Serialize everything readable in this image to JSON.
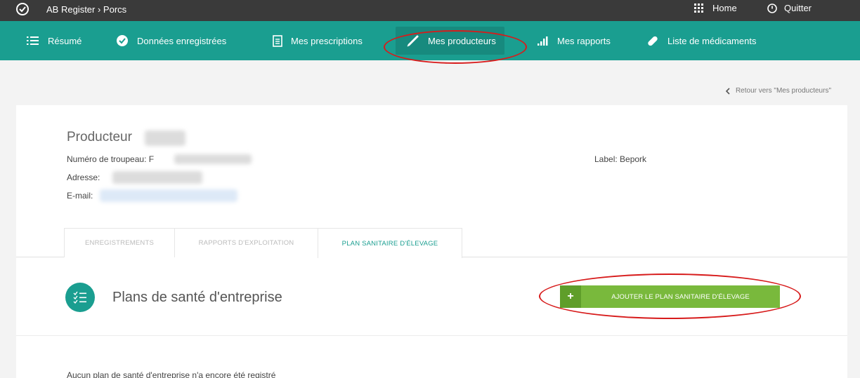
{
  "topbar": {
    "title": "AB Register › Porcs",
    "home_label": "Home",
    "quit_label": "Quitter"
  },
  "nav": {
    "items": [
      {
        "label": "Résumé",
        "icon": "list-icon"
      },
      {
        "label": "Données enregistrées",
        "icon": "check-circle-icon"
      },
      {
        "label": "Mes prescriptions",
        "icon": "document-icon"
      },
      {
        "label": "Mes producteurs",
        "icon": "syringe-icon",
        "active": true
      },
      {
        "label": "Mes rapports",
        "icon": "bar-chart-icon"
      },
      {
        "label": "Liste de médicaments",
        "icon": "pill-icon"
      }
    ]
  },
  "back_link": "Retour vers \"Mes producteurs\"",
  "producer": {
    "title": "Producteur",
    "herd_label": "Numéro de troupeau: F",
    "address_label": "Adresse:",
    "email_label": "E-mail:",
    "label": "Label: Bepork"
  },
  "tabs": [
    {
      "label": "ENREGISTREMENTS"
    },
    {
      "label": "RAPPORTS D'EXPLOITATION"
    },
    {
      "label": "PLAN SANITAIRE D'ÉLEVAGE",
      "active": true
    }
  ],
  "section": {
    "title": "Plans de santé d'entreprise",
    "add_button": "AJOUTER LE PLAN SANITAIRE D'ÉLEVAGE",
    "empty_message": "Aucun plan de santé d'entreprise n'a encore été registré"
  },
  "colors": {
    "teal": "#1a9e90",
    "green": "#79b93c",
    "annotation_red": "#d71b1b"
  }
}
